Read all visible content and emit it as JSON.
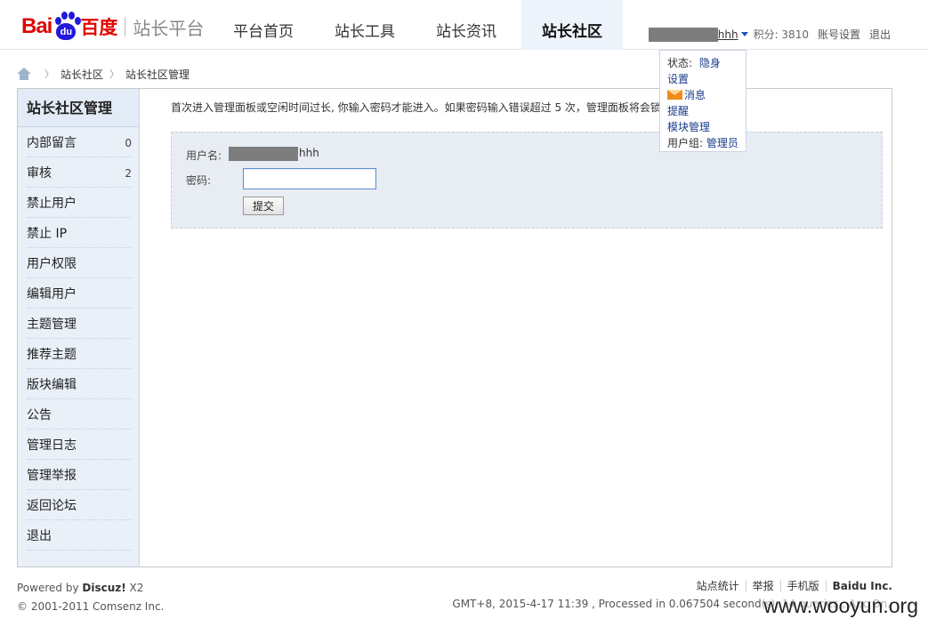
{
  "header": {
    "logo": {
      "bai": "Bai",
      "du": "du",
      "cn": "百度",
      "platform": "站长平台"
    },
    "nav": [
      {
        "label": "平台首页",
        "active": false
      },
      {
        "label": "站长工具",
        "active": false
      },
      {
        "label": "站长资讯",
        "active": false
      },
      {
        "label": "站长社区",
        "active": true
      }
    ],
    "user": {
      "name_suffix": "hhh",
      "points": "积分: 3810",
      "account_settings": "账号设置",
      "logout": "退出"
    }
  },
  "dropdown": {
    "status_label": "状态:",
    "status_value": "隐身",
    "settings": "设置",
    "messages": "消息",
    "remind": "提醒",
    "module_manage": "模块管理",
    "group_label": "用户组:",
    "group_value": "管理员"
  },
  "breadcrumb": [
    "站长社区",
    "站长社区管理"
  ],
  "sidebar": {
    "title": "站长社区管理",
    "items": [
      {
        "label": "内部留言",
        "count": "0"
      },
      {
        "label": "审核",
        "count": "2"
      },
      {
        "label": "禁止用户",
        "count": ""
      },
      {
        "label": "禁止 IP",
        "count": ""
      },
      {
        "label": "用户权限",
        "count": ""
      },
      {
        "label": "编辑用户",
        "count": ""
      },
      {
        "label": "主题管理",
        "count": ""
      },
      {
        "label": "推荐主题",
        "count": ""
      },
      {
        "label": "版块编辑",
        "count": ""
      },
      {
        "label": "公告",
        "count": ""
      },
      {
        "label": "管理日志",
        "count": ""
      },
      {
        "label": "管理举报",
        "count": ""
      },
      {
        "label": "返回论坛",
        "count": ""
      },
      {
        "label": "退出",
        "count": ""
      }
    ]
  },
  "content": {
    "notice": "首次进入管理面板或空闲时间过长, 你输入密码才能进入。如果密码输入错误超过 5 次，管理面板将会锁",
    "form": {
      "username_label": "用户名:",
      "username_suffix": "hhh",
      "password_label": "密码:",
      "password_value": "",
      "submit_label": "提交"
    }
  },
  "footer": {
    "powered_prefix": "Powered by ",
    "powered_brand": "Discuz!",
    "powered_version": " X2",
    "copyright": "© 2001-2011 Comsenz Inc.",
    "links": [
      "站点统计",
      "举报",
      "手机版"
    ],
    "company": "Baidu Inc.",
    "processed": "GMT+8, 2015-4-17 11:39 , Processed in 0.067504 second(s), 14 queries , Apc On.",
    "watermark": "www.wooyun.org"
  },
  "colors": {
    "brand_red": "#e10601",
    "brand_blue": "#2319dc",
    "sidebar_bg": "#e9f0f8",
    "form_bg": "#e8edf3",
    "link_blue": "#1b3c8a"
  }
}
